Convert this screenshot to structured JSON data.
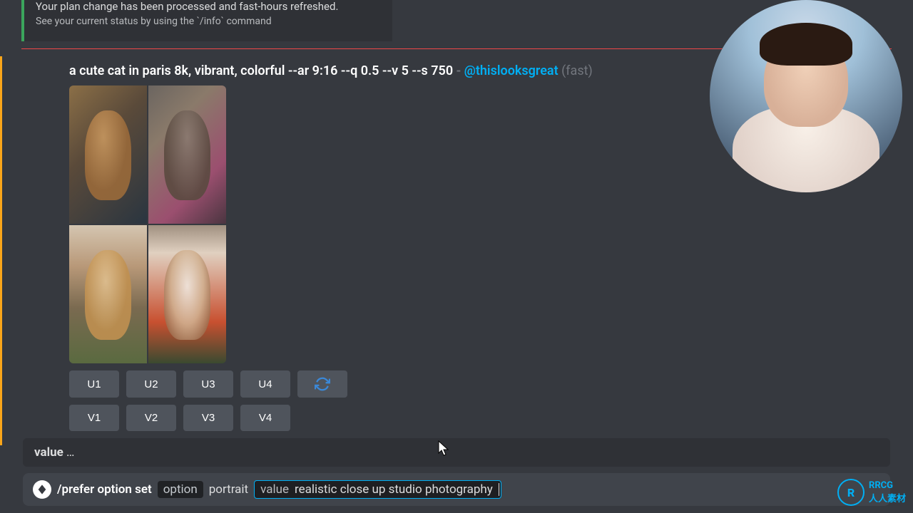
{
  "system_message": {
    "line1": "Your plan change has been processed and fast-hours refreshed.",
    "line2": "See your current status by using the `/info` command"
  },
  "message": {
    "prompt": "a cute cat in paris 8k, vibrant, colorful --ar 9:16 --q 0.5 --v 5 --s 750",
    "dash": "-",
    "mention": "@thislooksgreat",
    "mode": "(fast)"
  },
  "buttons": {
    "upscale": [
      "U1",
      "U2",
      "U3",
      "U4"
    ],
    "variations": [
      "V1",
      "V2",
      "V3",
      "V4"
    ]
  },
  "autocomplete": {
    "label": "value",
    "hint": "…"
  },
  "input": {
    "command": "/prefer option set",
    "param1_name": "option",
    "param1_value": "portrait",
    "param2_name": "value",
    "param2_value": "realistic close up studio photography"
  },
  "watermark": {
    "logo": "R",
    "text_cn": "人人素材",
    "text_en": "RRCG"
  }
}
